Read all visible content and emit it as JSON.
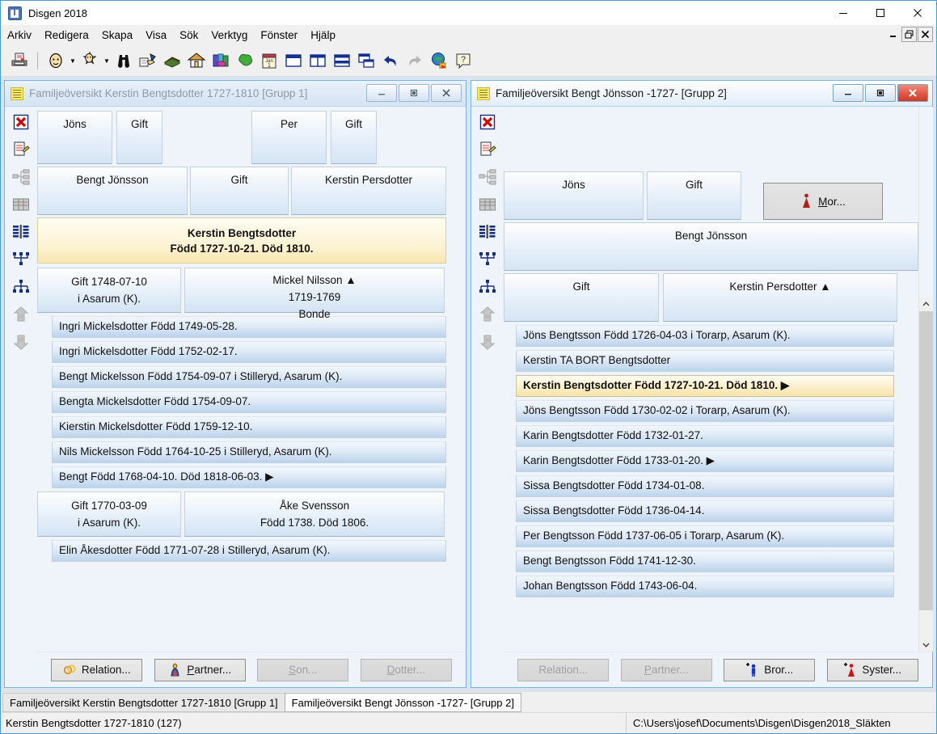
{
  "window": {
    "title": "Disgen 2018",
    "icon": "disgen-app-icon",
    "controls": {
      "minimize": "minimize-icon",
      "maximize": "maximize-icon",
      "close": "close-icon"
    }
  },
  "menubar": {
    "items": [
      "Arkiv",
      "Redigera",
      "Skapa",
      "Visa",
      "Sök",
      "Verktyg",
      "Fönster",
      "Hjälp"
    ],
    "mdi_controls": [
      "mdi-minimize-icon",
      "mdi-restore-icon",
      "mdi-close-icon"
    ]
  },
  "toolbar": {
    "buttons": [
      "print-icon",
      "separator",
      "person-icon",
      "dropdown-caret",
      "person-star-icon",
      "dropdown-caret",
      "binoculars-icon",
      "pointing-hand-icon",
      "book-icon",
      "house-icon",
      "books-icon",
      "tree-icon",
      "calendar-icon",
      "window-single-icon",
      "window-vertical-tile-icon",
      "window-horizontal-tile-icon",
      "window-cascade-icon",
      "undo-icon",
      "redo-icon",
      "globe-icon",
      "help-icon"
    ]
  },
  "rail_icons": [
    "delete-red-x-icon",
    "edit-note-icon",
    "tree-structure-icon",
    "table-grid-icon",
    "columns-icon",
    "descendant-chart-icon",
    "ancestor-chart-icon",
    "ancestor-up-icon",
    "descendant-down-icon"
  ],
  "left_window": {
    "title": "Familjeöversikt Kerstin Bengtsdotter 1727-1810 [Grupp 1]",
    "active": false,
    "icon": "note-yellow-icon",
    "controls": {
      "minimize": "minimize-icon",
      "maximize": "maximize-icon",
      "close": "close-icon"
    },
    "grandparents": [
      {
        "label": "Jöns"
      },
      {
        "label": "Gift"
      },
      {
        "label": "Per"
      },
      {
        "label": "Gift"
      }
    ],
    "parents": [
      {
        "label": "Bengt Jönsson"
      },
      {
        "label": "Gift"
      },
      {
        "label": "Kerstin Persdotter"
      }
    ],
    "focus_person": {
      "line1": "Kerstin Bengtsdotter",
      "line2": "Född 1727-10-21. Död 1810."
    },
    "marriages": [
      {
        "marriage_line1": "Gift 1748-07-10",
        "marriage_line2": "i  Asarum (K).",
        "spouse_line1": "Mickel Nilsson ▲",
        "spouse_line2": "1719-1769",
        "spouse_line3": "Bonde",
        "children": [
          "Ingri Mickelsdotter Född 1749-05-28.",
          "Ingri Mickelsdotter Född 1752-02-17.",
          "Bengt Mickelsson Född 1754-09-07 i Stilleryd, Asarum (K).",
          "Bengta Mickelsdotter Född 1754-09-07.",
          "Kierstin Mickelsdotter Född 1759-12-10.",
          "Nils Mickelsson Född 1764-10-25 i Stilleryd, Asarum (K).",
          "Bengt  Född 1768-04-10. Död 1818-06-03. ▶"
        ]
      },
      {
        "marriage_line1": "Gift 1770-03-09",
        "marriage_line2": "i  Asarum (K).",
        "spouse_line1": "Åke Svensson",
        "spouse_line2": "Född 1738. Död 1806.",
        "spouse_line3": "",
        "children": [
          "Elin Åkesdotter Född 1771-07-28 i Stilleryd, Asarum (K)."
        ]
      }
    ],
    "buttons": [
      {
        "label": "Relation...",
        "icon": "rings-icon",
        "disabled": false,
        "accel": ""
      },
      {
        "label": "Partner...",
        "icon": "partner-icon",
        "disabled": false,
        "accel": "P"
      },
      {
        "label": "Son...",
        "icon": "",
        "disabled": true,
        "accel": "S"
      },
      {
        "label": "Dotter...",
        "icon": "",
        "disabled": true,
        "accel": "D"
      }
    ]
  },
  "right_window": {
    "title": "Familjeöversikt Bengt Jönsson -1727- [Grupp 2]",
    "active": true,
    "icon": "note-yellow-icon",
    "controls": {
      "minimize": "minimize-icon",
      "maximize": "maximize-icon",
      "close": "close-icon"
    },
    "grandparents": [
      {
        "label": "Jöns"
      },
      {
        "label": "Gift"
      }
    ],
    "mother_button": {
      "label": "Mor...",
      "accel": "M",
      "icon": "female-red-icon"
    },
    "person": {
      "label": "Bengt Jönsson"
    },
    "marriage": {
      "label": "Gift"
    },
    "spouse": {
      "label": "Kerstin Persdotter ▲"
    },
    "children": [
      {
        "label": "Jöns Bengtsson Född 1726-04-03 i Torarp, Asarum (K).",
        "selected": false
      },
      {
        "label": "Kerstin TA BORT Bengtsdotter",
        "selected": false
      },
      {
        "label": "Kerstin Bengtsdotter Född 1727-10-21. Död 1810. ▶",
        "selected": true
      },
      {
        "label": "Jöns Bengtsson Född 1730-02-02 i Torarp, Asarum (K).",
        "selected": false
      },
      {
        "label": "Karin Bengtsdotter Född 1732-01-27.",
        "selected": false
      },
      {
        "label": "Karin Bengtsdotter Född 1733-01-20. ▶",
        "selected": false
      },
      {
        "label": "Sissa Bengtsdotter Född 1734-01-08.",
        "selected": false
      },
      {
        "label": "Sissa Bengtsdotter Född 1736-04-14.",
        "selected": false
      },
      {
        "label": "Per Bengtsson Född 1737-06-05 i Torarp, Asarum (K).",
        "selected": false
      },
      {
        "label": "Bengt Bengtsson Född 1741-12-30.",
        "selected": false
      },
      {
        "label": "Johan Bengtsson Född 1743-06-04.",
        "selected": false
      }
    ],
    "scrollbar": {
      "up": "scroll-up-arrow-icon",
      "down": "scroll-down-arrow-icon"
    },
    "buttons": [
      {
        "label": "Relation...",
        "icon": "",
        "disabled": true,
        "accel": ""
      },
      {
        "label": "Partner...",
        "icon": "",
        "disabled": true,
        "accel": "P"
      },
      {
        "label": "Bror...",
        "icon": "male-blue-plus-icon",
        "disabled": false,
        "accel": ""
      },
      {
        "label": "Syster...",
        "icon": "female-red-plus-icon",
        "disabled": false,
        "accel": ""
      }
    ]
  },
  "taskbar": {
    "tabs": [
      {
        "label": "Familjeöversikt Kerstin Bengtsdotter 1727-1810 [Grupp 1]",
        "active": false
      },
      {
        "label": "Familjeöversikt Bengt Jönsson -1727- [Grupp 2]",
        "active": true
      }
    ]
  },
  "statusbar": {
    "left": "Kerstin Bengtsdotter 1727-1810 (127)",
    "right": "C:\\Users\\josef\\Documents\\Disgen\\Disgen2018_Släkten"
  },
  "colors": {
    "mdi_background": "#d9e6f2",
    "focus_yellow": "#fae7ae",
    "accent_blue": "#4a9ad4",
    "close_red": "#cf3a26"
  }
}
